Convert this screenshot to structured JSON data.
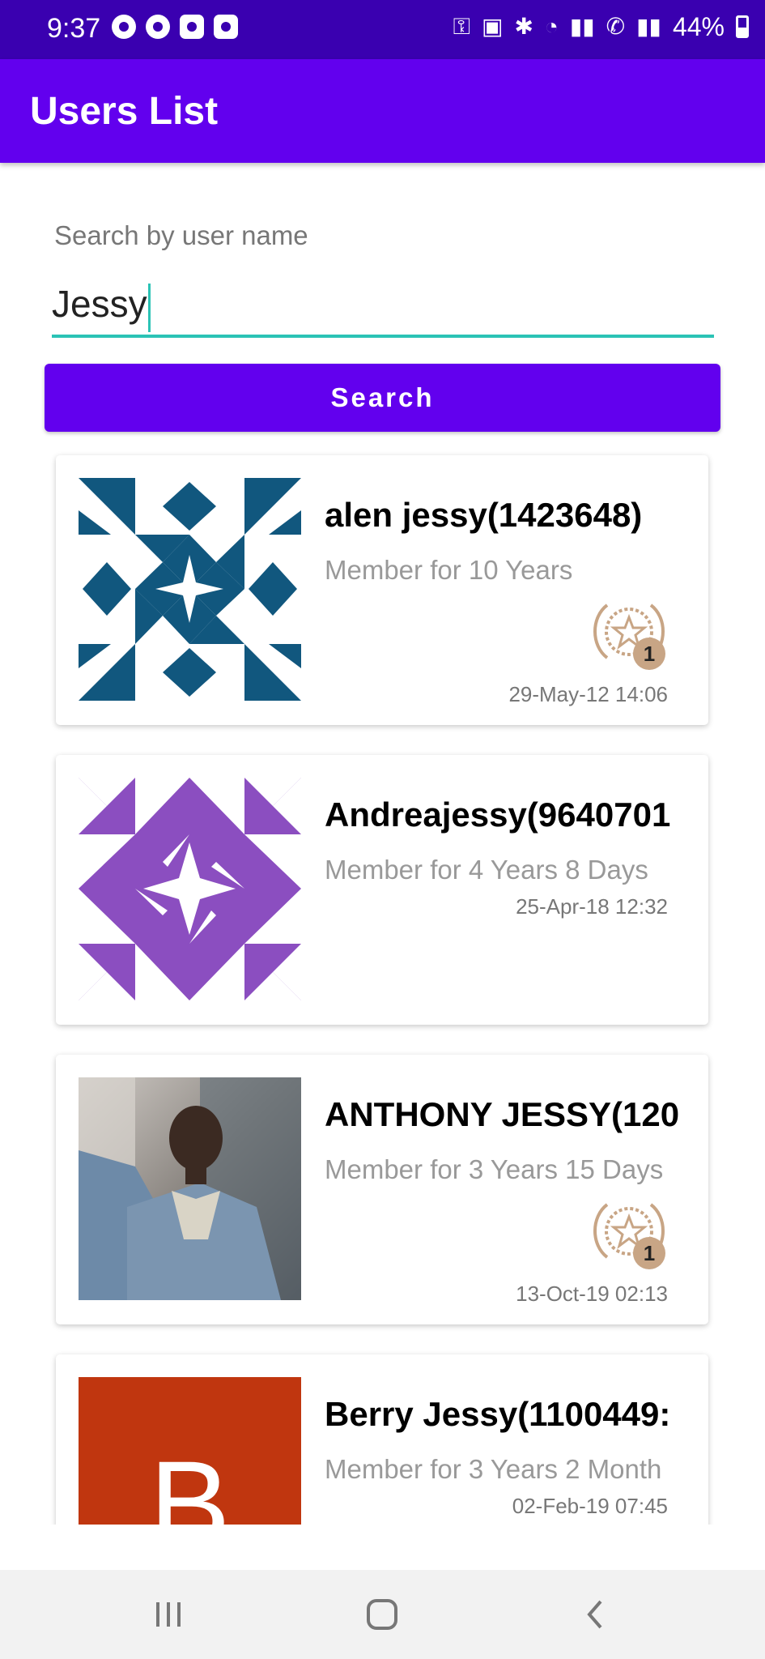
{
  "status_bar": {
    "time": "9:37",
    "battery": "44%"
  },
  "app_bar": {
    "title": "Users List"
  },
  "search": {
    "label": "Search by user name",
    "value": "Jessy",
    "button_label": "Search"
  },
  "users": [
    {
      "name": "alen jessy(1423648)",
      "member": "Member for 10 Years",
      "date": "29-May-12 14:06",
      "badge_count": "1"
    },
    {
      "name": "Andreajessy(9640701",
      "member": "Member for 4 Years 8 Days",
      "date": "25-Apr-18 12:32"
    },
    {
      "name": "ANTHONY JESSY(120",
      "member": "Member for 3 Years 15 Days",
      "date": "13-Oct-19 02:13",
      "badge_count": "1"
    },
    {
      "name": "Berry Jessy(1100449:",
      "member": "Member for 3 Years 2 Month",
      "date": "02-Feb-19 07:45",
      "avatar_letter": "B"
    }
  ],
  "colors": {
    "primary": "#6200ee",
    "status_bar": "#3a00b0",
    "accent": "#2bc3b5",
    "badge": "#c8a585"
  }
}
